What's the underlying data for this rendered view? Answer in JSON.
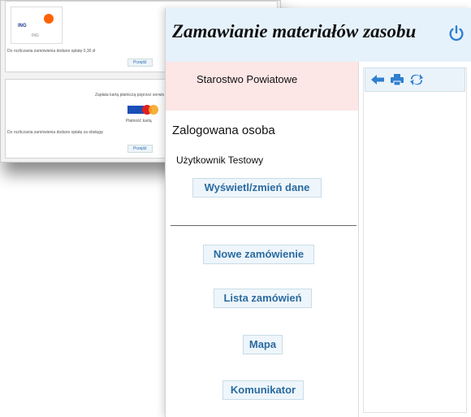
{
  "background_window": {
    "bank_name": "ING",
    "bank_sub": "ING",
    "note_1": "Do rozliczania zamówienia dodano opłatę 0,30 zł",
    "btn_1": "Przejdź",
    "card_heading": "Zapłata kartą płatniczą poprzez serwis",
    "card_label": "Płatność kartą",
    "note_2": "Do rozliczania zamówienia dodano opłatę za obsługę",
    "btn_2": "Przejdź"
  },
  "header": {
    "title": "Zamawianie materiałów zasobu",
    "power_icon": "power-icon",
    "accent_color": "#2f7fd0"
  },
  "sidebar": {
    "org_name": "Starostwo Powiatowe",
    "logged_heading": "Zalogowana osoba",
    "user_name": "Użytkownik Testowy",
    "edit_button": "Wyświetl/zmień dane",
    "menu": {
      "new_order": "Nowe zamówienie",
      "order_list": "Lista zamówień",
      "map": "Mapa",
      "messenger": "Komunikator"
    }
  },
  "toolbar": {
    "icons": [
      "back-arrow-icon",
      "print-icon",
      "refresh-icon"
    ],
    "icon_color": "#2f7fd0"
  },
  "colors": {
    "header_bg": "#e6f2fb",
    "org_bg": "#fde6e6",
    "button_bg": "#eef6fb",
    "button_text": "#2b6aa0"
  }
}
